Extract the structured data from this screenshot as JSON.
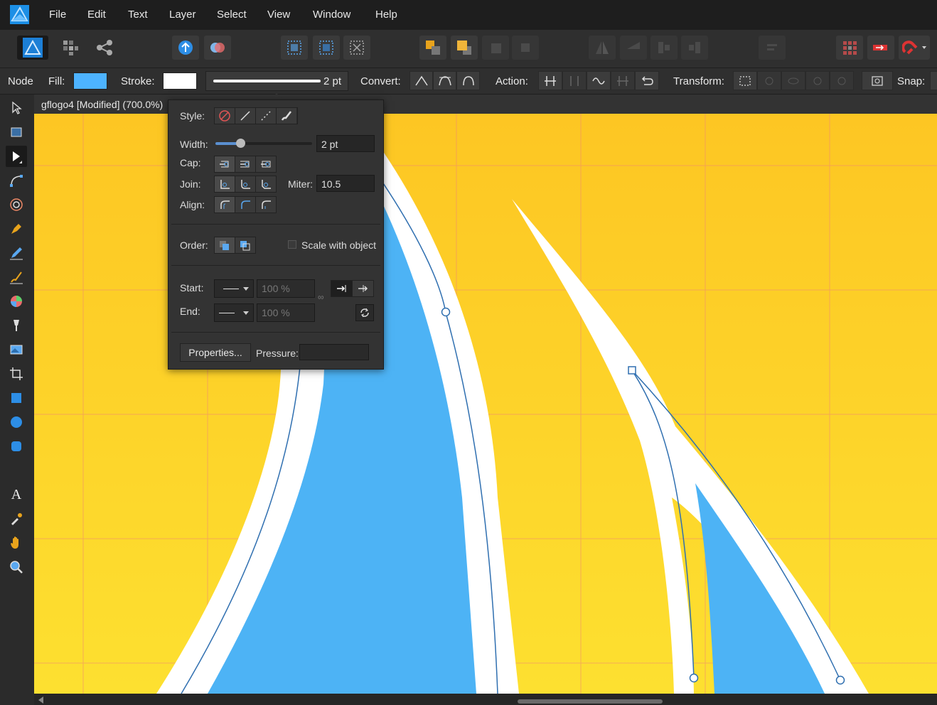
{
  "menu": [
    "File",
    "Edit",
    "Text",
    "Layer",
    "Select",
    "View",
    "Window",
    "Help"
  ],
  "context": {
    "tool_name": "Node",
    "fill_label": "Fill:",
    "fill_color": "#4db3ff",
    "stroke_label": "Stroke:",
    "stroke_color": "#ffffff",
    "stroke_width": "2 pt",
    "convert_label": "Convert:",
    "action_label": "Action:",
    "transform_label": "Transform:",
    "snap_label": "Snap:"
  },
  "document": {
    "title": "gflogo4 [Modified] (700.0%)"
  },
  "stroke_panel": {
    "style_label": "Style:",
    "width_label": "Width:",
    "width_value": "2 pt",
    "width_slider_fraction": 0.26,
    "cap_label": "Cap:",
    "join_label": "Join:",
    "miter_label": "Miter:",
    "miter_value": "10.5",
    "align_label": "Align:",
    "order_label": "Order:",
    "scale_label": "Scale with object",
    "scale_checked": false,
    "start_label": "Start:",
    "end_label": "End:",
    "start_scale": "100 %",
    "end_scale": "100 %",
    "properties_button": "Properties...",
    "pressure_label": "Pressure:"
  },
  "colors": {
    "canvas_yellow": "#fdc623",
    "shape_blue": "#4db3f5",
    "path_blue": "#2f6fb0",
    "grid_red": "#f08a70"
  },
  "icons": {
    "tools": [
      "move-icon",
      "artboard-icon",
      "node-icon",
      "corner-icon",
      "contour-icon",
      "pen-icon",
      "pencil-icon",
      "vector-brush-icon",
      "fill-icon",
      "transparency-icon",
      "place-image-icon",
      "crop-icon",
      "rectangle-icon",
      "ellipse-icon",
      "rounded-rect-icon",
      "crescent-icon",
      "text-icon",
      "color-picker-icon",
      "hand-icon",
      "zoom-icon"
    ]
  }
}
